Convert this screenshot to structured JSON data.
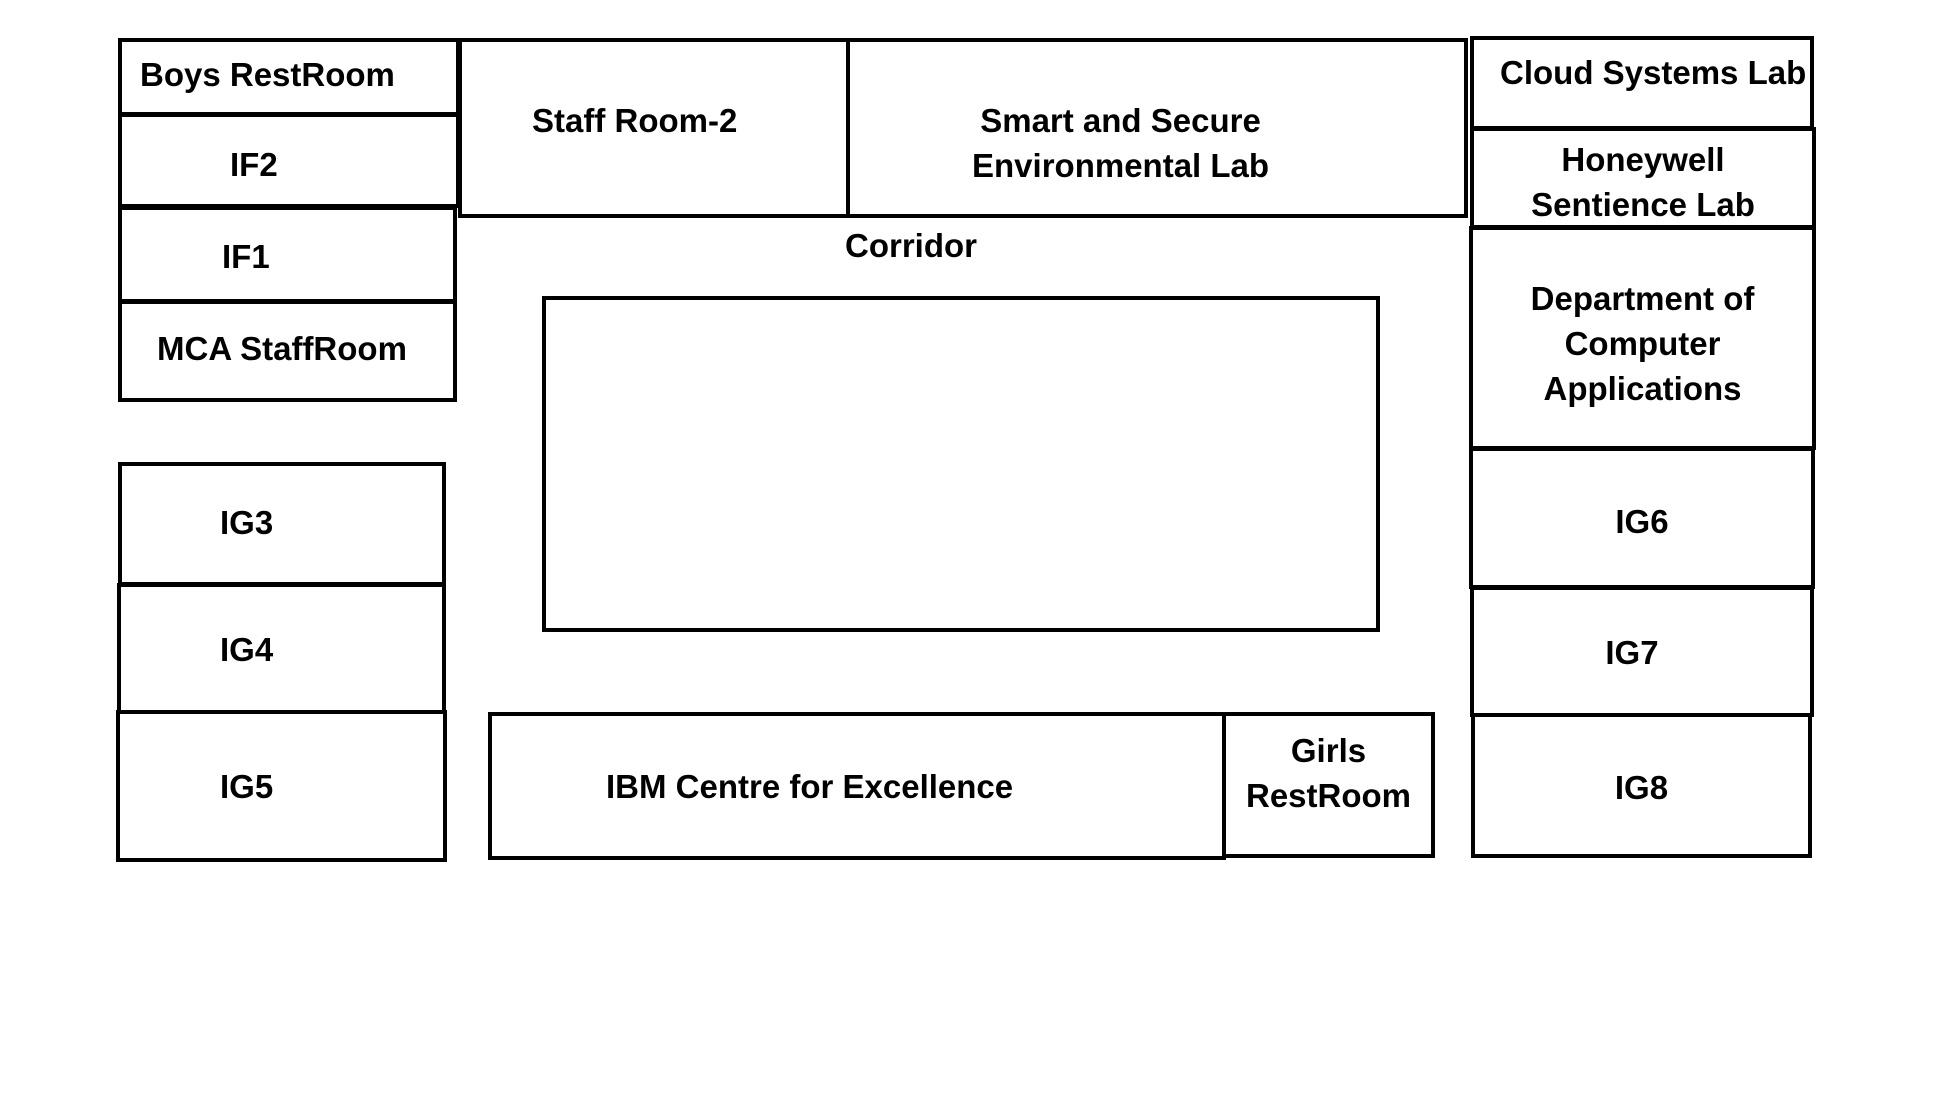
{
  "floor_plan": {
    "corridor": "Corridor",
    "rooms": {
      "boys_restroom": "Boys RestRoom",
      "if2": "IF2",
      "if1": "IF1",
      "mca_staffroom": "MCA StaffRoom",
      "staff_room_2": "Staff  Room-2",
      "smart_secure_lab": "Smart and  Secure\nEnvironmental Lab",
      "cloud_systems_lab": "Cloud Systems Lab",
      "honeywell_lab": "Honeywell\nSentience  Lab",
      "dept_computer_applications": "Department of\nComputer\nApplications",
      "ig3": "IG3",
      "ig4": "IG4",
      "ig5": "IG5",
      "ig6": "IG6",
      "ig7": "IG7",
      "ig8": "IG8",
      "ibm_centre": "IBM Centre  for  Excellence",
      "girls_restroom": "Girls\nRestRoom"
    }
  }
}
